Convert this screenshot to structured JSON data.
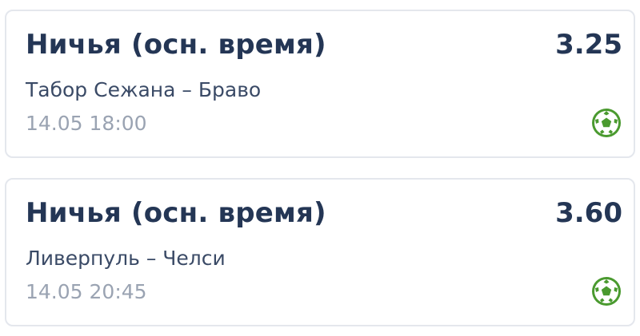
{
  "bets": [
    {
      "market": "Ничья (осн. время)",
      "odds": "3.25",
      "match": "Табор Сежана – Браво",
      "datetime": "14.05 18:00",
      "sport_icon": "soccer-ball-icon"
    },
    {
      "market": "Ничья (осн. время)",
      "odds": "3.60",
      "match": "Ливерпуль – Челси",
      "datetime": "14.05 20:45",
      "sport_icon": "soccer-ball-icon"
    }
  ],
  "colors": {
    "title": "#243655",
    "match": "#3a4a66",
    "datetime": "#9aa3b2",
    "sport_icon": "#4a9a2f",
    "card_border": "#e4e7ed"
  }
}
